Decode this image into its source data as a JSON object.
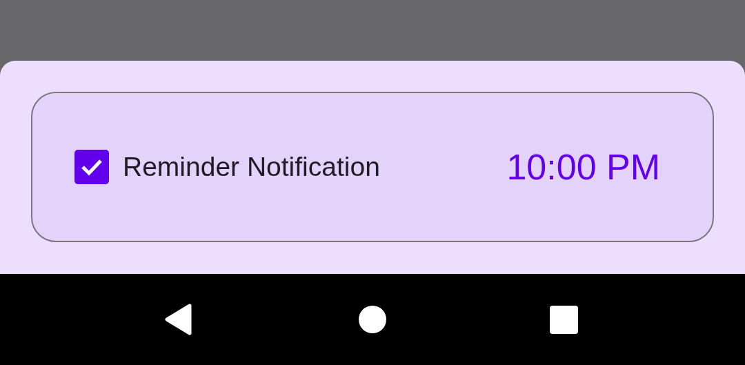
{
  "reminder": {
    "checked": true,
    "label": "Reminder Notification",
    "time": "10:00 PM"
  }
}
